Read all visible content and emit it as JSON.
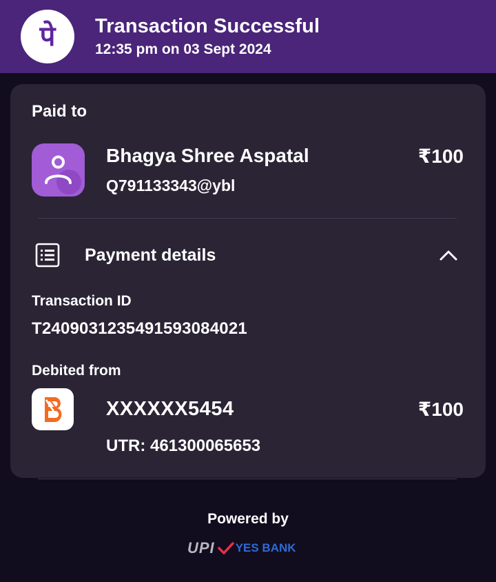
{
  "header": {
    "title": "Transaction Successful",
    "subtitle": "12:35 pm on 03 Sept 2024",
    "logo_glyph": "पे",
    "bg_color": "#4a2579"
  },
  "paid_to": {
    "label": "Paid to",
    "name": "Bhagya Shree Aspatal",
    "upi_id": "Q791133343@ybl",
    "amount": "₹100"
  },
  "payment_details": {
    "label": "Payment details",
    "expanded": true,
    "transaction_id_label": "Transaction ID",
    "transaction_id": "T2409031235491593084021",
    "debited_from_label": "Debited from",
    "account": "XXXXXX5454",
    "amount": "₹100",
    "utr": "UTR: 461300065653"
  },
  "footer": {
    "powered_by": "Powered by",
    "upi_text": "UPI",
    "bank_name": "YES BANK"
  },
  "colors": {
    "accent": "#4a2579",
    "background": "#110d1e",
    "card": "#2a2435",
    "avatar": "#a25cd6",
    "bank_orange": "#f26b21"
  }
}
